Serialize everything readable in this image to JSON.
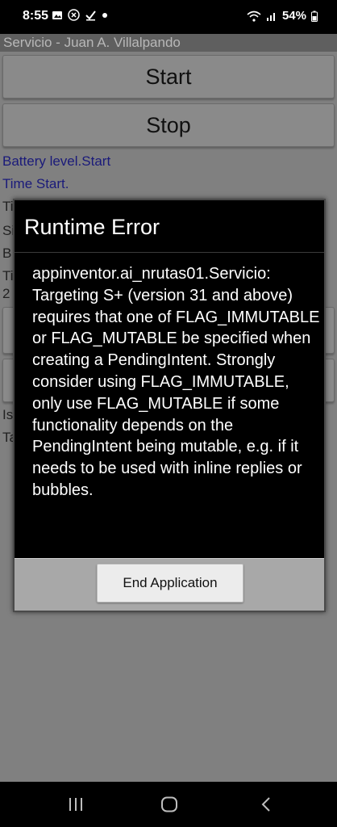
{
  "status_bar": {
    "time": "8:55",
    "battery_percent": "54%",
    "icons": [
      "gallery-icon",
      "x-icon",
      "check-icon",
      "dot-icon",
      "wifi-icon",
      "signal-icon",
      "battery-icon"
    ]
  },
  "app": {
    "title": "Servicio - Juan A. Villalpando",
    "start_button": "Start",
    "stop_button": "Stop",
    "battery_label": "Battery level.Start",
    "time_label": "Time Start.",
    "partial_labels": [
      "Ti",
      "Si",
      "B",
      "Ti",
      "2",
      "Is",
      "Ta"
    ]
  },
  "dialog": {
    "title": "Runtime Error",
    "message": "appinventor.ai_nrutas01.Servicio: Targeting S+ (version 31 and above) requires that one of FLAG_IMMUTABLE or FLAG_MUTABLE be specified when creating a PendingIntent. Strongly consider using FLAG_IMMUTABLE, only use FLAG_MUTABLE if some functionality depends on the PendingIntent being mutable, e.g. if it needs to be used with inline replies or bubbles.",
    "button": "End Application"
  },
  "colors": {
    "dialog_bg": "#000000",
    "dialog_footer": "#a8a8a8",
    "label_blue": "#1a1a7a"
  }
}
